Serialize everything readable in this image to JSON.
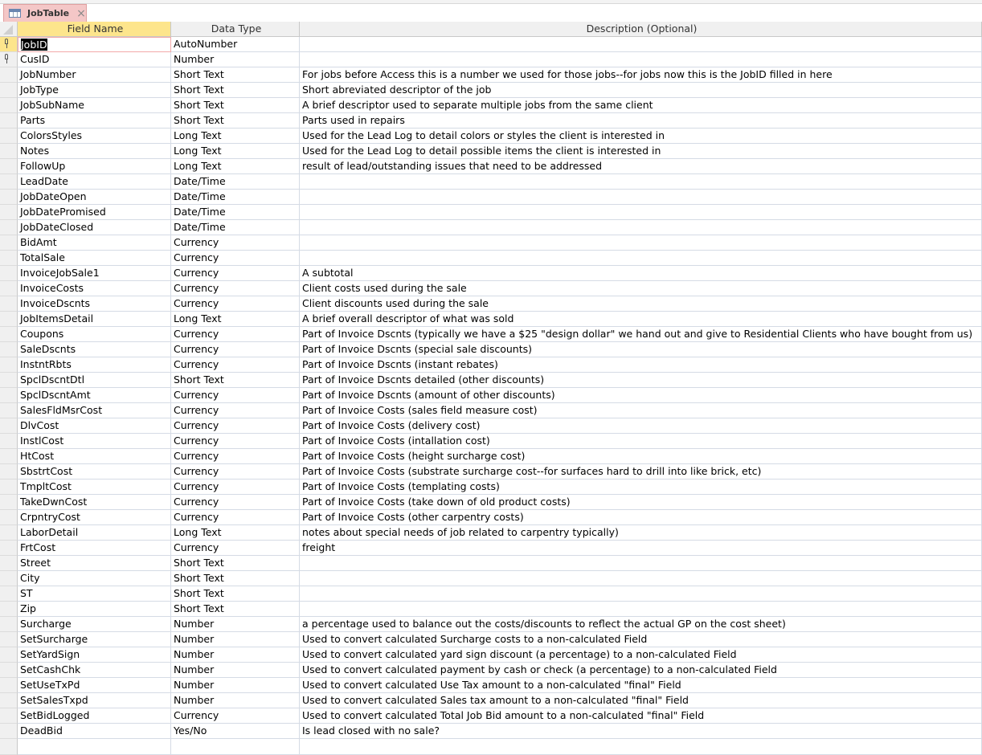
{
  "tab": {
    "title": "JobTable",
    "close": "×"
  },
  "headers": {
    "field_name": "Field Name",
    "data_type": "Data Type",
    "description": "Description (Optional)"
  },
  "rows": [
    {
      "name": "JobID",
      "type": "AutoNumber",
      "desc": "",
      "key": true
    },
    {
      "name": "CusID",
      "type": "Number",
      "desc": "",
      "key": true
    },
    {
      "name": "JobNumber",
      "type": "Short Text",
      "desc": "For jobs before Access this is a number we used for those jobs--for jobs now this is the JobID filled in here"
    },
    {
      "name": "JobType",
      "type": "Short Text",
      "desc": "Short abreviated descriptor of the job"
    },
    {
      "name": "JobSubName",
      "type": "Short Text",
      "desc": "A brief descriptor  used to separate multiple jobs from the same client"
    },
    {
      "name": "Parts",
      "type": "Short Text",
      "desc": "Parts used in repairs"
    },
    {
      "name": "ColorsStyles",
      "type": "Long Text",
      "desc": "Used for the Lead Log to detail colors or styles the client is interested in"
    },
    {
      "name": "Notes",
      "type": "Long Text",
      "desc": "Used for the Lead Log to detail possible items the client is interested in"
    },
    {
      "name": "FollowUp",
      "type": "Long Text",
      "desc": "result of lead/outstanding issues that need to be addressed"
    },
    {
      "name": "LeadDate",
      "type": "Date/Time",
      "desc": ""
    },
    {
      "name": "JobDateOpen",
      "type": "Date/Time",
      "desc": ""
    },
    {
      "name": "JobDatePromised",
      "type": "Date/Time",
      "desc": ""
    },
    {
      "name": "JobDateClosed",
      "type": "Date/Time",
      "desc": ""
    },
    {
      "name": "BidAmt",
      "type": "Currency",
      "desc": ""
    },
    {
      "name": "TotalSale",
      "type": "Currency",
      "desc": ""
    },
    {
      "name": "InvoiceJobSale1",
      "type": "Currency",
      "desc": "A subtotal"
    },
    {
      "name": "InvoiceCosts",
      "type": "Currency",
      "desc": "Client costs used during the sale"
    },
    {
      "name": "InvoiceDscnts",
      "type": "Currency",
      "desc": "Client discounts used during the sale"
    },
    {
      "name": "JobItemsDetail",
      "type": "Long Text",
      "desc": "A brief overall descriptor of what was sold"
    },
    {
      "name": "Coupons",
      "type": "Currency",
      "desc": "Part of Invoice Dscnts (typically we have a $25 \"design dollar\" we hand out and give to Residential Clients who have bought from us)"
    },
    {
      "name": "SaleDscnts",
      "type": "Currency",
      "desc": "Part of Invoice Dscnts (special sale discounts)"
    },
    {
      "name": "InstntRbts",
      "type": "Currency",
      "desc": "Part of Invoice Dscnts (instant rebates)"
    },
    {
      "name": "SpclDscntDtl",
      "type": "Short Text",
      "desc": "Part of Invoice Dscnts detailed (other discounts)"
    },
    {
      "name": "SpclDscntAmt",
      "type": "Currency",
      "desc": "Part of Invoice Dscnts (amount of other discounts)"
    },
    {
      "name": "SalesFldMsrCost",
      "type": "Currency",
      "desc": "Part of Invoice Costs (sales field measure cost)"
    },
    {
      "name": "DlvCost",
      "type": "Currency",
      "desc": "Part of Invoice Costs (delivery cost)"
    },
    {
      "name": "InstlCost",
      "type": "Currency",
      "desc": "Part of Invoice Costs (intallation cost)"
    },
    {
      "name": "HtCost",
      "type": "Currency",
      "desc": "Part of Invoice Costs (height surcharge cost)"
    },
    {
      "name": "SbstrtCost",
      "type": "Currency",
      "desc": "Part of Invoice Costs (substrate surcharge cost--for surfaces hard to drill into like brick, etc)"
    },
    {
      "name": "TmpltCost",
      "type": "Currency",
      "desc": "Part of Invoice Costs (templating costs)"
    },
    {
      "name": "TakeDwnCost",
      "type": "Currency",
      "desc": "Part of Invoice Costs (take down of old product costs)"
    },
    {
      "name": "CrpntryCost",
      "type": "Currency",
      "desc": "Part of Invoice Costs (other carpentry costs)"
    },
    {
      "name": "LaborDetail",
      "type": "Long Text",
      "desc": "notes about special needs of job related to carpentry typically)"
    },
    {
      "name": "FrtCost",
      "type": "Currency",
      "desc": "freight"
    },
    {
      "name": "Street",
      "type": "Short Text",
      "desc": ""
    },
    {
      "name": "City",
      "type": "Short Text",
      "desc": ""
    },
    {
      "name": "ST",
      "type": "Short Text",
      "desc": ""
    },
    {
      "name": "Zip",
      "type": "Short Text",
      "desc": ""
    },
    {
      "name": "Surcharge",
      "type": "Number",
      "desc": "a percentage used to balance out the costs/discounts to reflect the actual GP on the cost sheet)"
    },
    {
      "name": "SetSurcharge",
      "type": "Number",
      "desc": "Used to convert calculated Surcharge costs to a non-calculated Field"
    },
    {
      "name": "SetYardSign",
      "type": "Number",
      "desc": "Used to convert calculated yard sign discount (a percentage) to a non-calculated Field"
    },
    {
      "name": "SetCashChk",
      "type": "Number",
      "desc": "Used to convert calculated payment by cash or check (a percentage) to a non-calculated Field"
    },
    {
      "name": "SetUseTxPd",
      "type": "Number",
      "desc": "Used to convert calculated Use Tax amount to a non-calculated \"final\" Field"
    },
    {
      "name": "SetSalesTxpd",
      "type": "Number",
      "desc": "Used to convert calculated Sales tax amount to a non-calculated \"final\" Field"
    },
    {
      "name": "SetBidLogged",
      "type": "Currency",
      "desc": "Used to convert calculated Total Job Bid amount to a non-calculated \"final\" Field"
    },
    {
      "name": "DeadBid",
      "type": "Yes/No",
      "desc": "Is lead closed with no sale?"
    }
  ]
}
